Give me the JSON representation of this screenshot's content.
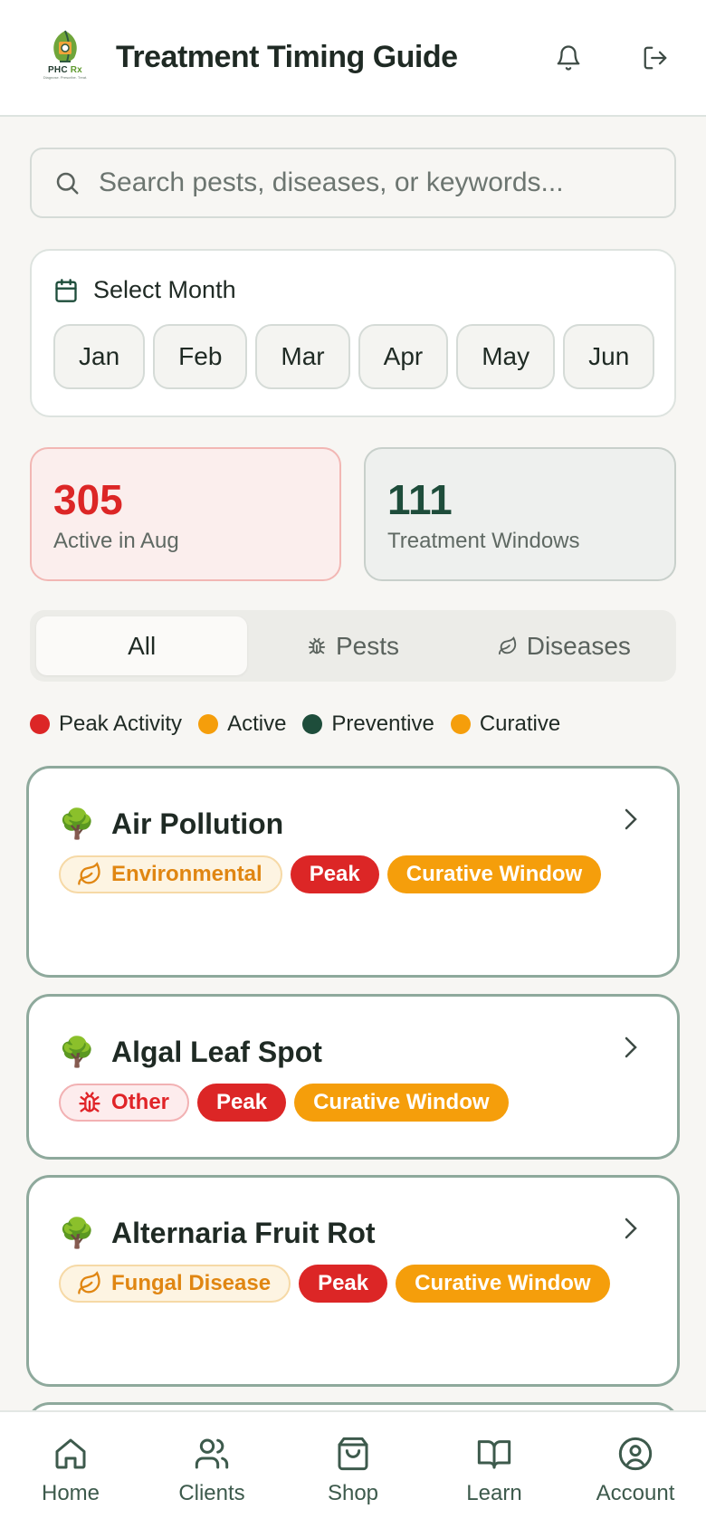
{
  "header": {
    "title": "Treatment Timing Guide",
    "logo_main": "PHC",
    "logo_rx": "Rx",
    "logo_tagline": "Diagnose. Prescribe. Treat.",
    "icons": [
      "bell-icon",
      "logout-icon"
    ]
  },
  "search": {
    "placeholder": "Search pests, diseases, or keywords..."
  },
  "month_select": {
    "label": "Select Month",
    "months": [
      "Jan",
      "Feb",
      "Mar",
      "Apr",
      "May",
      "Jun"
    ]
  },
  "stats": {
    "active": {
      "value": "305",
      "label": "Active in Aug"
    },
    "windows": {
      "value": "111",
      "label": "Treatment Windows"
    }
  },
  "tabs": {
    "all": "All",
    "pests": "Pests",
    "diseases": "Diseases"
  },
  "legend": [
    {
      "label": "Peak Activity",
      "color": "#dc2626"
    },
    {
      "label": "Active",
      "color": "#f59e0b"
    },
    {
      "label": "Preventive",
      "color": "#1e4d3b"
    },
    {
      "label": "Curative",
      "color": "#f59e0b"
    }
  ],
  "cards": [
    {
      "name": "Air Pollution",
      "icon": "🌳",
      "category": "Environmental",
      "peak": "Peak",
      "window": "Curative Window"
    },
    {
      "name": "Algal Leaf Spot",
      "icon": "🌳",
      "category": "Other",
      "peak": "Peak",
      "window": "Curative Window"
    },
    {
      "name": "Alternaria Fruit Rot",
      "icon": "🌳",
      "category": "Fungal Disease",
      "peak": "Peak",
      "window": "Curative Window"
    }
  ],
  "nav": {
    "home": "Home",
    "clients": "Clients",
    "shop": "Shop",
    "learn": "Learn",
    "account": "Account"
  }
}
